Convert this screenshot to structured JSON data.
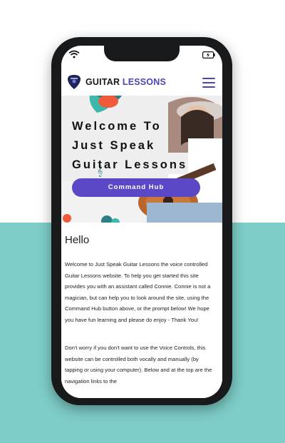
{
  "status": {
    "wifi_icon": "wifi-icon",
    "battery_icon": "battery-charging-icon"
  },
  "header": {
    "logo_icon": "guitar-pick-logo",
    "brand_part1": "GUITAR ",
    "brand_part2": "LESSONS",
    "menu_icon": "hamburger-menu-icon"
  },
  "hero": {
    "title_lines": [
      "Welcome To",
      "Just Speak",
      "Guitar Lessons"
    ],
    "button_label": "Command Hub"
  },
  "content": {
    "heading": "Hello",
    "paragraph1": "Welcome to Just Speak Guitar Lessons the voice controlled Guitar Lessons website. To help you get started this site provides you with an assistant called Connie. Connie is not a magician, but can help you to look around the site, using the Command Hub button above, or the prompt below! We hope you have fun learning and please do enjoy - Thank You!",
    "paragraph2": "Don't worry if you don't want to use the Voice Controls, this website can be controlled both vocally and manually (by tapping or using your computer). Below and at the top are the navigation links to the"
  },
  "colors": {
    "accent": "#4a47b5",
    "button": "#5a48c7",
    "background_bottom": "#7ecdc8",
    "phone_frame": "#17191b"
  }
}
